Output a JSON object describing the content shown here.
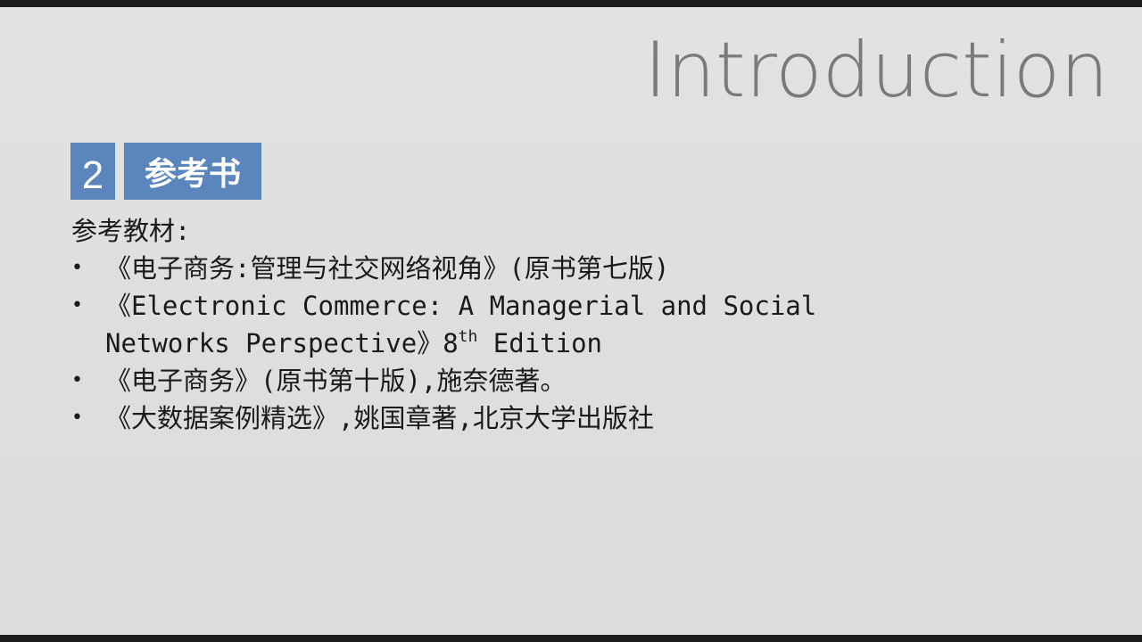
{
  "slide": {
    "title": "Introduction",
    "section": {
      "number": "2",
      "label": "参考书"
    },
    "intro": "参考教材:",
    "references": [
      {
        "text": "《电子商务:管理与社交网络视角》(原书第七版)"
      },
      {
        "text": "《Electronic Commerce: A Managerial and Social Networks Perspective》8",
        "sup": "th",
        "tail": " Edition"
      },
      {
        "text": "《电子商务》(原书第十版),施奈德著。"
      },
      {
        "text": "《大数据案例精选》,姚国章著,北京大学出版社"
      }
    ]
  },
  "colors": {
    "accent": "#5b86bd",
    "title": "#7a7a7a",
    "background": "#e0e0e0",
    "text": "#1a1a1a"
  }
}
